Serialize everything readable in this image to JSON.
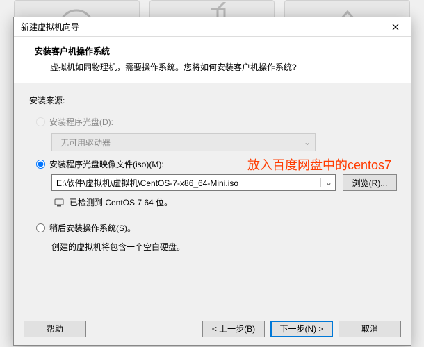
{
  "dialog": {
    "title": "新建虚拟机向导",
    "header_title": "安装客户机操作系统",
    "header_sub": "虚拟机如同物理机，需要操作系统。您将如何安装客户机操作系统?"
  },
  "source": {
    "label": "安装来源:",
    "opt_disc": "安装程序光盘(D):",
    "disc_combo": "无可用驱动器",
    "opt_iso": "安装程序光盘映像文件(iso)(M):",
    "iso_path": "E:\\软件\\虚拟机\\虚拟机\\CentOS-7-x86_64-Mini.iso",
    "browse": "浏览(R)...",
    "detected": "已检测到 CentOS 7 64 位。",
    "opt_later": "稍后安装操作系统(S)。",
    "later_desc": "创建的虚拟机将包含一个空白硬盘。"
  },
  "annotation": "放入百度网盘中的centos7",
  "footer": {
    "help": "帮助",
    "back": "< 上一步(B)",
    "next": "下一步(N) >",
    "cancel": "取消"
  }
}
